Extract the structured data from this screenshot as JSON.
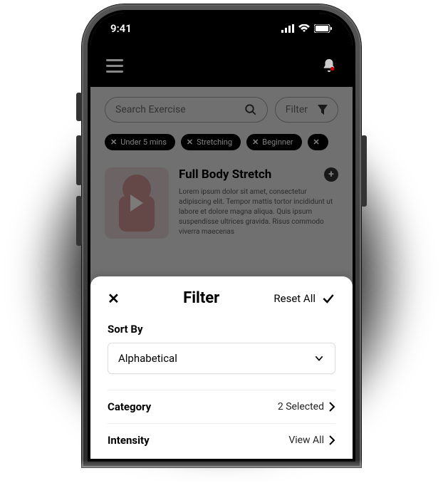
{
  "status": {
    "time": "9:41"
  },
  "search": {
    "placeholder": "Search Exercise",
    "filter_label": "Filter"
  },
  "chips": [
    "Under 5 mins",
    "Stretching",
    "Beginner"
  ],
  "card": {
    "title": "Full Body Stretch",
    "desc": "Lorem ipsum dolor sit amet, consectetur adipiscing elit. Tempor mattis tortor incididunt ut labore et dolore magna aliqua. Quis ipsum suspendisse ultrices gravida. Risus commodo viverra maecenas"
  },
  "sheet": {
    "title": "Filter",
    "reset_label": "Reset All",
    "sort_label": "Sort By",
    "sort_value": "Alphabetical",
    "rows": [
      {
        "label": "Category",
        "value": "2 Selected"
      },
      {
        "label": "Intensity",
        "value": "View All"
      }
    ]
  }
}
